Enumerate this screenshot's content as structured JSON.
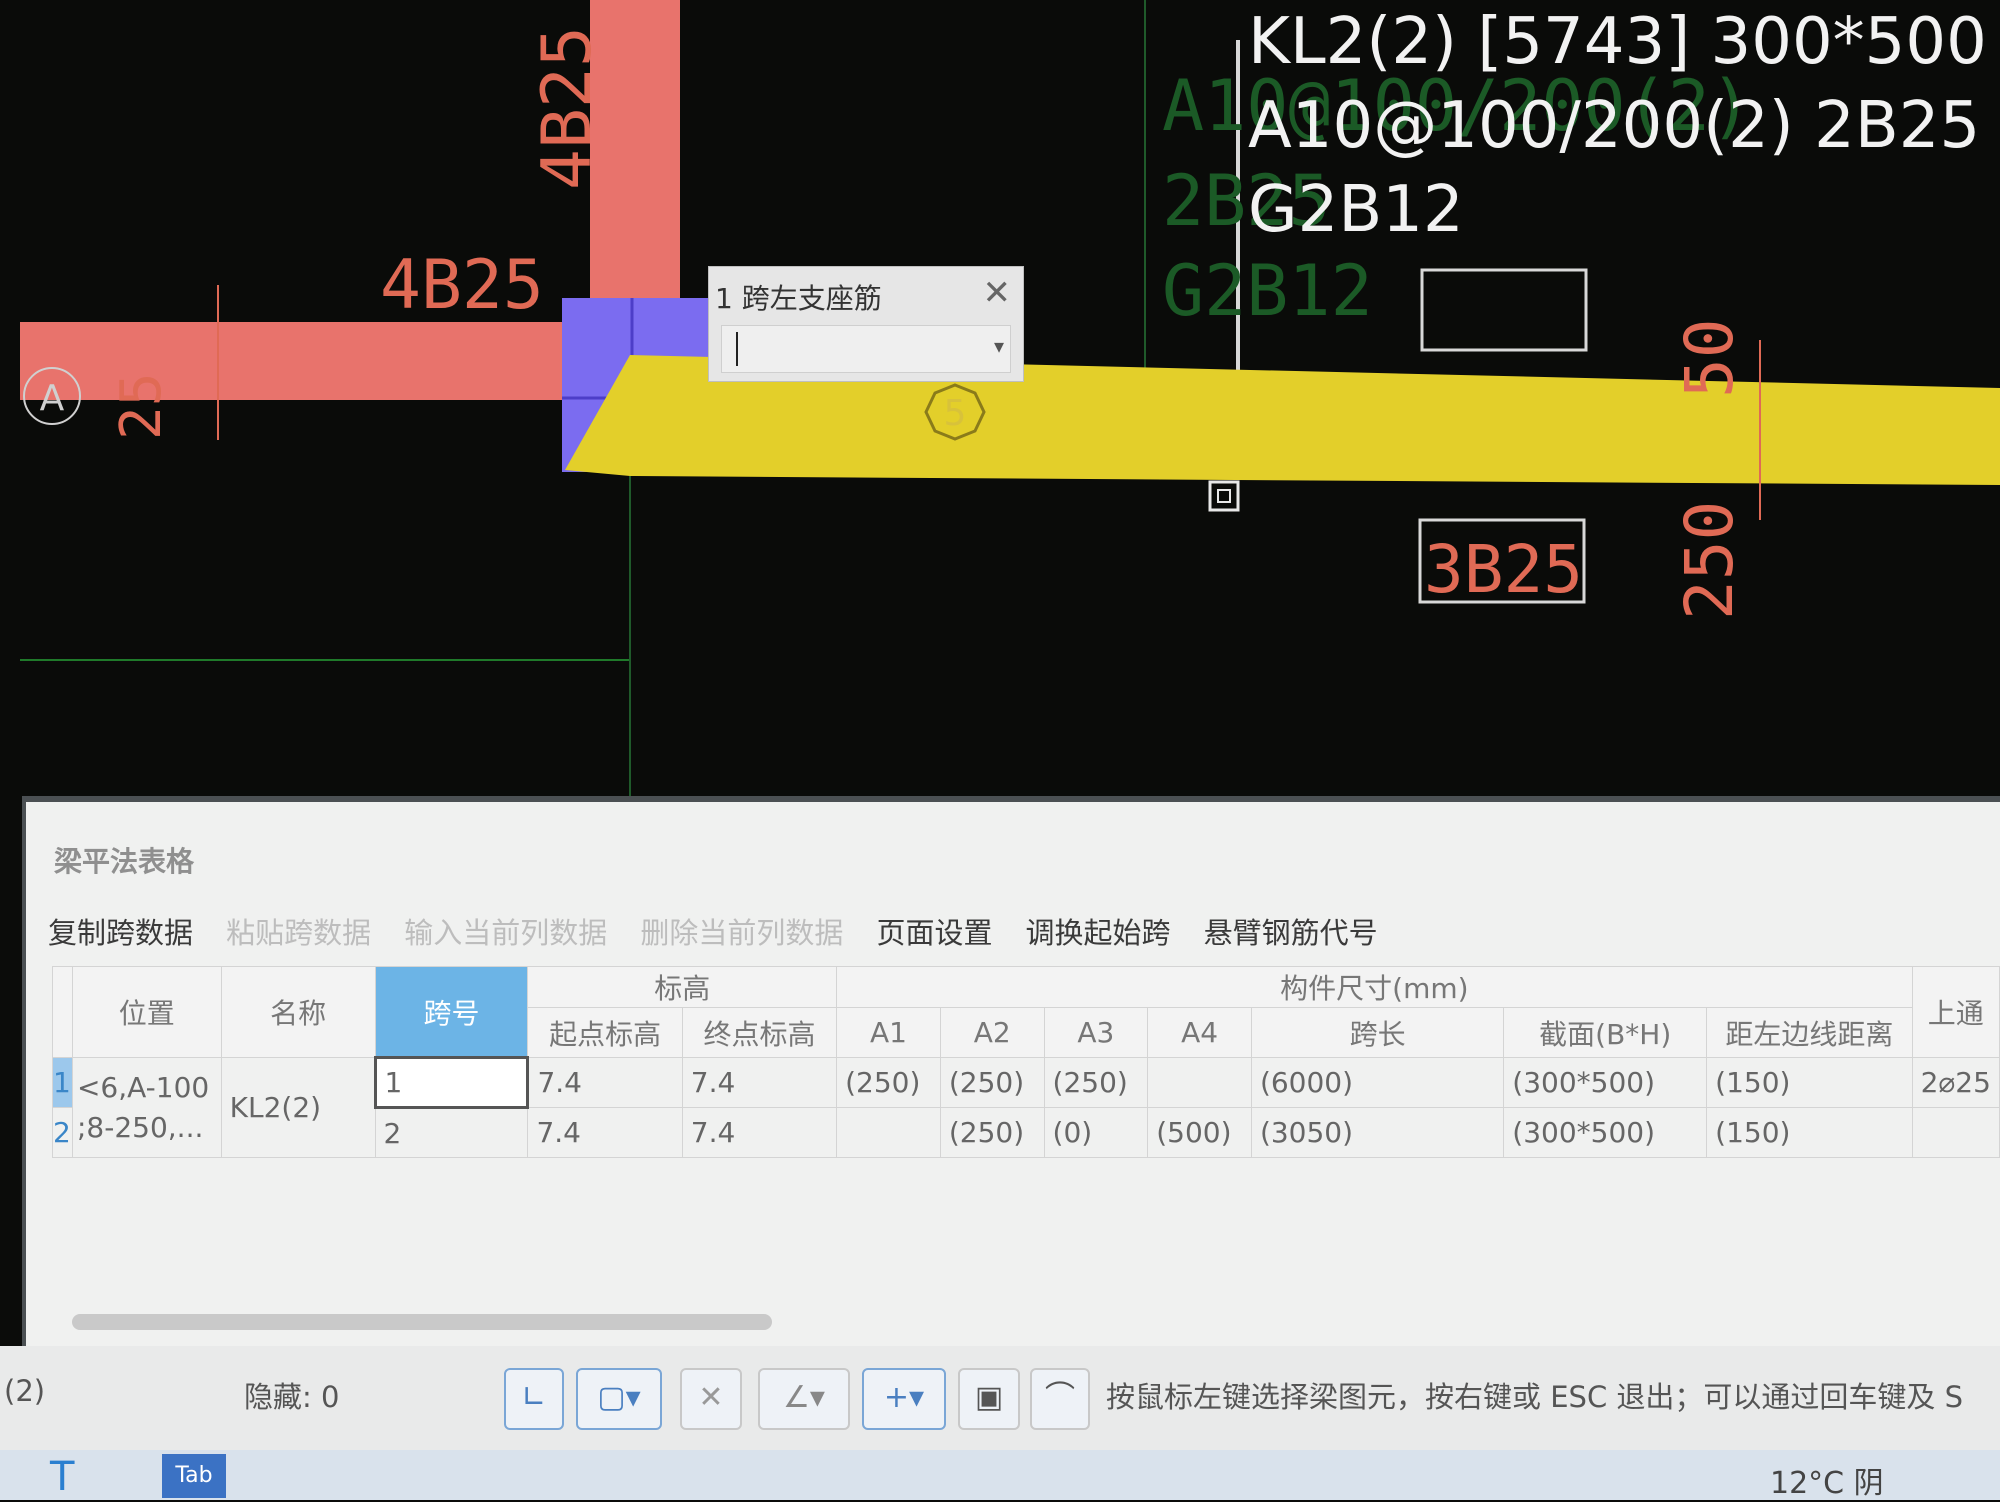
{
  "cad": {
    "label_4b25_top": "4B25",
    "label_4b25_left": "4B25",
    "label_axis_a": "A",
    "label_25": "25",
    "label_5": "5",
    "label_3b25": "3B25",
    "label_250": "250",
    "label_50": "50",
    "faint_line1": "A10@100/200(2)",
    "faint_line2": "2B25",
    "faint_line3": "G2B12",
    "info_line1": "KL2(2) [5743] 300*500",
    "info_line2": "A10@100/200(2) 2B25",
    "info_line3": "G2B12",
    "colors": {
      "beam_red": "#e8736c",
      "beam_yellow": "#e3cf2a",
      "column_blue": "#7b6cf0",
      "annotation_red": "#e06a55"
    }
  },
  "popup": {
    "title": "1 跨左支座筋",
    "close_icon": "close-icon",
    "dropdown_icon": "chevron-down-icon"
  },
  "panel": {
    "title": "梁平法表格",
    "toolbar": [
      {
        "label": "复制跨数据",
        "enabled": true
      },
      {
        "label": "粘贴跨数据",
        "enabled": false
      },
      {
        "label": "输入当前列数据",
        "enabled": false
      },
      {
        "label": "删除当前列数据",
        "enabled": false
      },
      {
        "label": "页面设置",
        "enabled": true
      },
      {
        "label": "调换起始跨",
        "enabled": true
      },
      {
        "label": "悬臂钢筋代号",
        "enabled": true
      }
    ],
    "headers": {
      "position": "位置",
      "name": "名称",
      "span_no": "跨号",
      "elevation_group": "标高",
      "start_elev": "起点标高",
      "end_elev": "终点标高",
      "size_group": "构件尺寸(mm)",
      "a1": "A1",
      "a2": "A2",
      "a3": "A3",
      "a4": "A4",
      "span_len": "跨长",
      "section": "截面(B*H)",
      "dist_left": "距左边线距离",
      "top_through": "上通"
    },
    "row_numbers": [
      "1",
      "2"
    ],
    "position_lines": [
      "<6,A-100",
      ";8-250,..."
    ],
    "name": "KL2(2)",
    "rows": [
      {
        "span": "1",
        "start": "7.4",
        "end": "7.4",
        "a1": "(250)",
        "a2": "(250)",
        "a3": "(250)",
        "a4": "",
        "len": "(6000)",
        "section": "(300*500)",
        "dist": "(150)",
        "top": "2⌀25"
      },
      {
        "span": "2",
        "start": "7.4",
        "end": "7.4",
        "a1": "",
        "a2": "(250)",
        "a3": "(0)",
        "a4": "(500)",
        "len": "(3050)",
        "section": "(300*500)",
        "dist": "(150)",
        "top": ""
      }
    ]
  },
  "status": {
    "left_text": "(2)",
    "hidden_label": "隐藏: 0",
    "hint": "按鼠标左键选择梁图元，按右键或 ESC 退出；可以通过回车键及 S"
  },
  "taskbar": {
    "weather": "12°C 阴",
    "app_icon_label": "Tab"
  }
}
